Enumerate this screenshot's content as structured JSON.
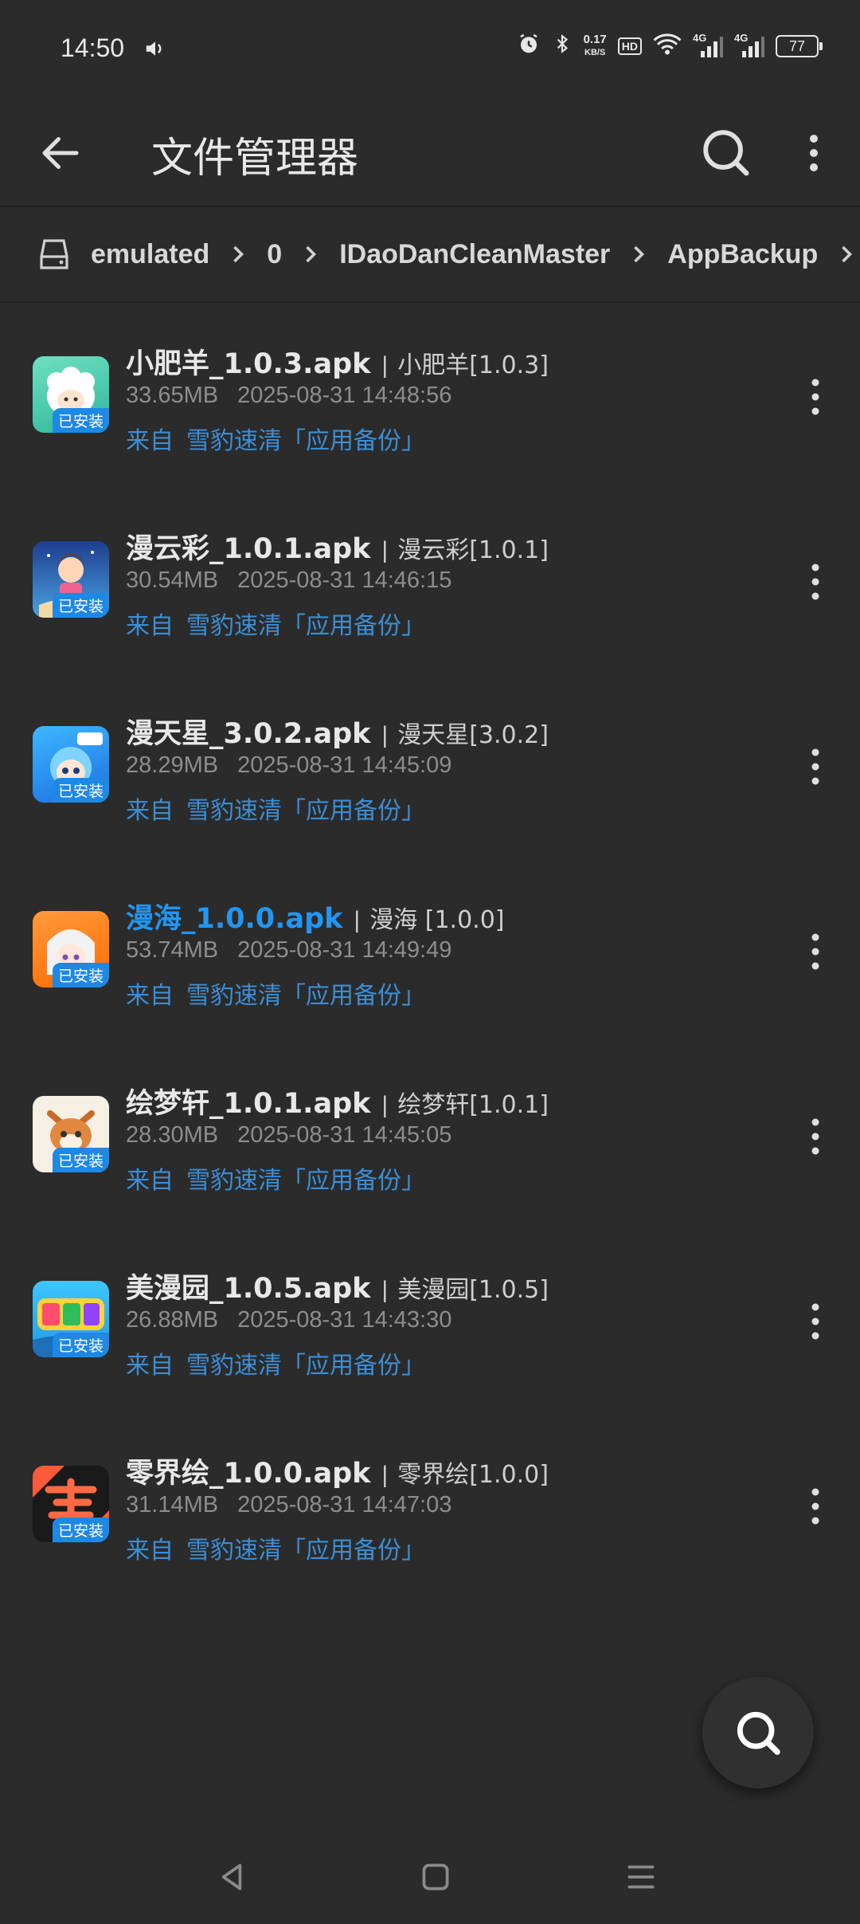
{
  "status_bar": {
    "time": "14:50",
    "net_speed_value": "0.17",
    "net_speed_unit": "KB/S",
    "hd_label": "HD",
    "signal_1_label": "4G",
    "signal_2_label": "4G",
    "battery": "77",
    "icons": [
      "volume-icon",
      "alarm-icon",
      "bluetooth-icon",
      "wifi-icon",
      "signal-icon",
      "battery-icon"
    ]
  },
  "app_bar": {
    "title": "文件管理器",
    "icons": [
      "back-arrow-icon",
      "search-icon",
      "more-vertical-icon"
    ]
  },
  "breadcrumb": {
    "icon": "storage-icon",
    "items": [
      "emulated",
      "0",
      "IDaoDanCleanMaster",
      "AppBackup"
    ]
  },
  "files": [
    {
      "filename": "小肥羊_1.0.3.apk",
      "app": "小肥羊[1.0.3]",
      "size": "33.65MB",
      "date": "2025-08-31 14:48:56",
      "source_label": "来自",
      "source": "雪豹速清「应用备份」",
      "badge": "已安装",
      "highlighted": false
    },
    {
      "filename": "漫云彩_1.0.1.apk",
      "app": "漫云彩[1.0.1]",
      "size": "30.54MB",
      "date": "2025-08-31 14:46:15",
      "source_label": "来自",
      "source": "雪豹速清「应用备份」",
      "badge": "已安装",
      "highlighted": false
    },
    {
      "filename": "漫天星_3.0.2.apk",
      "app": "漫天星[3.0.2]",
      "size": "28.29MB",
      "date": "2025-08-31 14:45:09",
      "source_label": "来自",
      "source": "雪豹速清「应用备份」",
      "badge": "已安装",
      "highlighted": false
    },
    {
      "filename": "漫海_1.0.0.apk",
      "app": "漫海  [1.0.0]",
      "size": "53.74MB",
      "date": "2025-08-31 14:49:49",
      "source_label": "来自",
      "source": "雪豹速清「应用备份」",
      "badge": "已安装",
      "highlighted": true
    },
    {
      "filename": "绘梦轩_1.0.1.apk",
      "app": "绘梦轩[1.0.1]",
      "size": "28.30MB",
      "date": "2025-08-31 14:45:05",
      "source_label": "来自",
      "source": "雪豹速清「应用备份」",
      "badge": "已安装",
      "highlighted": false
    },
    {
      "filename": "美漫园_1.0.5.apk",
      "app": "美漫园[1.0.5]",
      "size": "26.88MB",
      "date": "2025-08-31 14:43:30",
      "source_label": "来自",
      "source": "雪豹速清「应用备份」",
      "badge": "已安装",
      "highlighted": false
    },
    {
      "filename": "零界绘_1.0.0.apk",
      "app": "零界绘[1.0.0]",
      "size": "31.14MB",
      "date": "2025-08-31 14:47:03",
      "source_label": "来自",
      "source": "雪豹速清「应用备份」",
      "badge": "已安装",
      "highlighted": false
    }
  ],
  "fab": {
    "icon": "search-icon"
  },
  "nav_bar": {
    "icons": [
      "back-triangle-icon",
      "home-square-icon",
      "recents-menu-icon"
    ]
  },
  "colors": {
    "background": "#2b2b2b",
    "accent": "#2196f3",
    "link": "#3b8ed6",
    "badge": "#1e88e5"
  }
}
